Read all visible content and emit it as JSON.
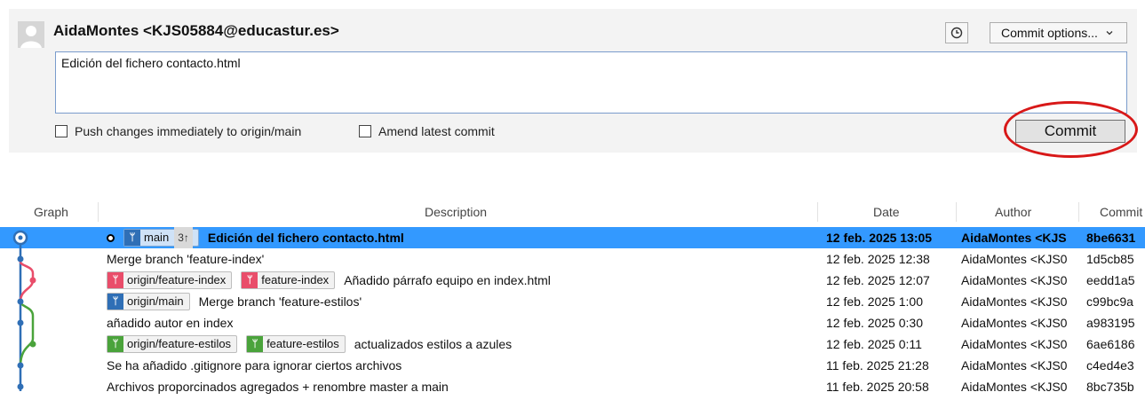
{
  "commit_panel": {
    "author": "AidaMontes <KJS05884@educastur.es>",
    "commit_options_label": "Commit options...",
    "message": "Edición del fichero contacto.html",
    "push_label": "Push changes immediately to origin/main",
    "amend_label": "Amend latest commit",
    "commit_button": "Commit"
  },
  "log": {
    "headers": {
      "graph": "Graph",
      "description": "Description",
      "date": "Date",
      "author": "Author",
      "commit": "Commit"
    },
    "rows": [
      {
        "tags": [
          {
            "label": "main",
            "color": "blue",
            "count": "3↑"
          }
        ],
        "message": "Edición del fichero contacto.html",
        "date": "12 feb. 2025 13:05",
        "author": "AidaMontes <KJS",
        "hash": "8be6631"
      },
      {
        "tags": [],
        "message": "Merge branch 'feature-index'",
        "date": "12 feb. 2025 12:38",
        "author": "AidaMontes <KJS0",
        "hash": "1d5cb85"
      },
      {
        "tags": [
          {
            "label": "origin/feature-index",
            "color": "red"
          },
          {
            "label": "feature-index",
            "color": "red"
          }
        ],
        "message": "Añadido párrafo equipo en index.html",
        "date": "12 feb. 2025 12:07",
        "author": "AidaMontes <KJS0",
        "hash": "eedd1a5"
      },
      {
        "tags": [
          {
            "label": "origin/main",
            "color": "blue"
          }
        ],
        "message": "Merge branch 'feature-estilos'",
        "date": "12 feb. 2025 1:00",
        "author": "AidaMontes <KJS0",
        "hash": "c99bc9a"
      },
      {
        "tags": [],
        "message": "añadido autor en index",
        "date": "12 feb. 2025 0:30",
        "author": "AidaMontes <KJS0",
        "hash": "a983195"
      },
      {
        "tags": [
          {
            "label": "origin/feature-estilos",
            "color": "green"
          },
          {
            "label": "feature-estilos",
            "color": "green"
          }
        ],
        "message": "actualizados estilos a azules",
        "date": "12 feb. 2025 0:11",
        "author": "AidaMontes <KJS0",
        "hash": "6ae6186"
      },
      {
        "tags": [],
        "message": "Se ha añadido .gitignore para ignorar ciertos archivos",
        "date": "11 feb. 2025 21:28",
        "author": "AidaMontes <KJS0",
        "hash": "c4ed4e3"
      },
      {
        "tags": [],
        "message": "Archivos proporcinados agregados + renombre master a main",
        "date": "11 feb. 2025 20:58",
        "author": "AidaMontes <KJS0",
        "hash": "8bc735b"
      }
    ]
  },
  "colors": {
    "selection": "#3399ff",
    "main": "#2f6fb6",
    "feature_index": "#e94d6a",
    "feature_estilos": "#4aa33b",
    "highlight_circle": "#d81818"
  }
}
